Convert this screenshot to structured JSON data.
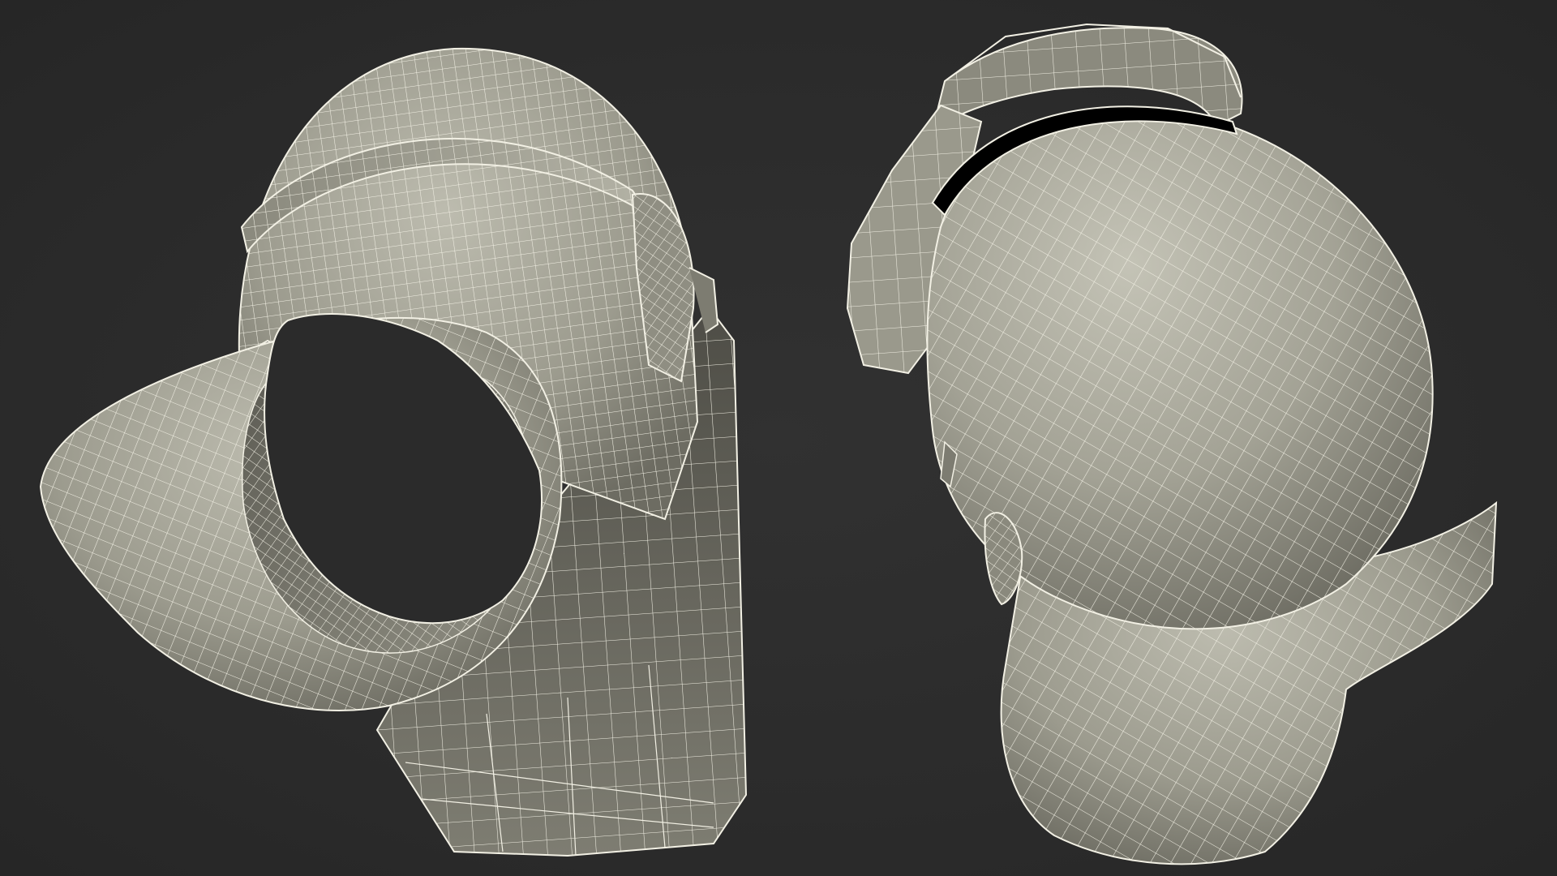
{
  "scene": {
    "background_color": "#2a2a2a",
    "surface_color": "#9a998c",
    "wire_color": "#f2f0e4",
    "objects": [
      {
        "name": "helmet-front-wireframe-view"
      },
      {
        "name": "helmet-rear-wireframe-view"
      }
    ]
  }
}
